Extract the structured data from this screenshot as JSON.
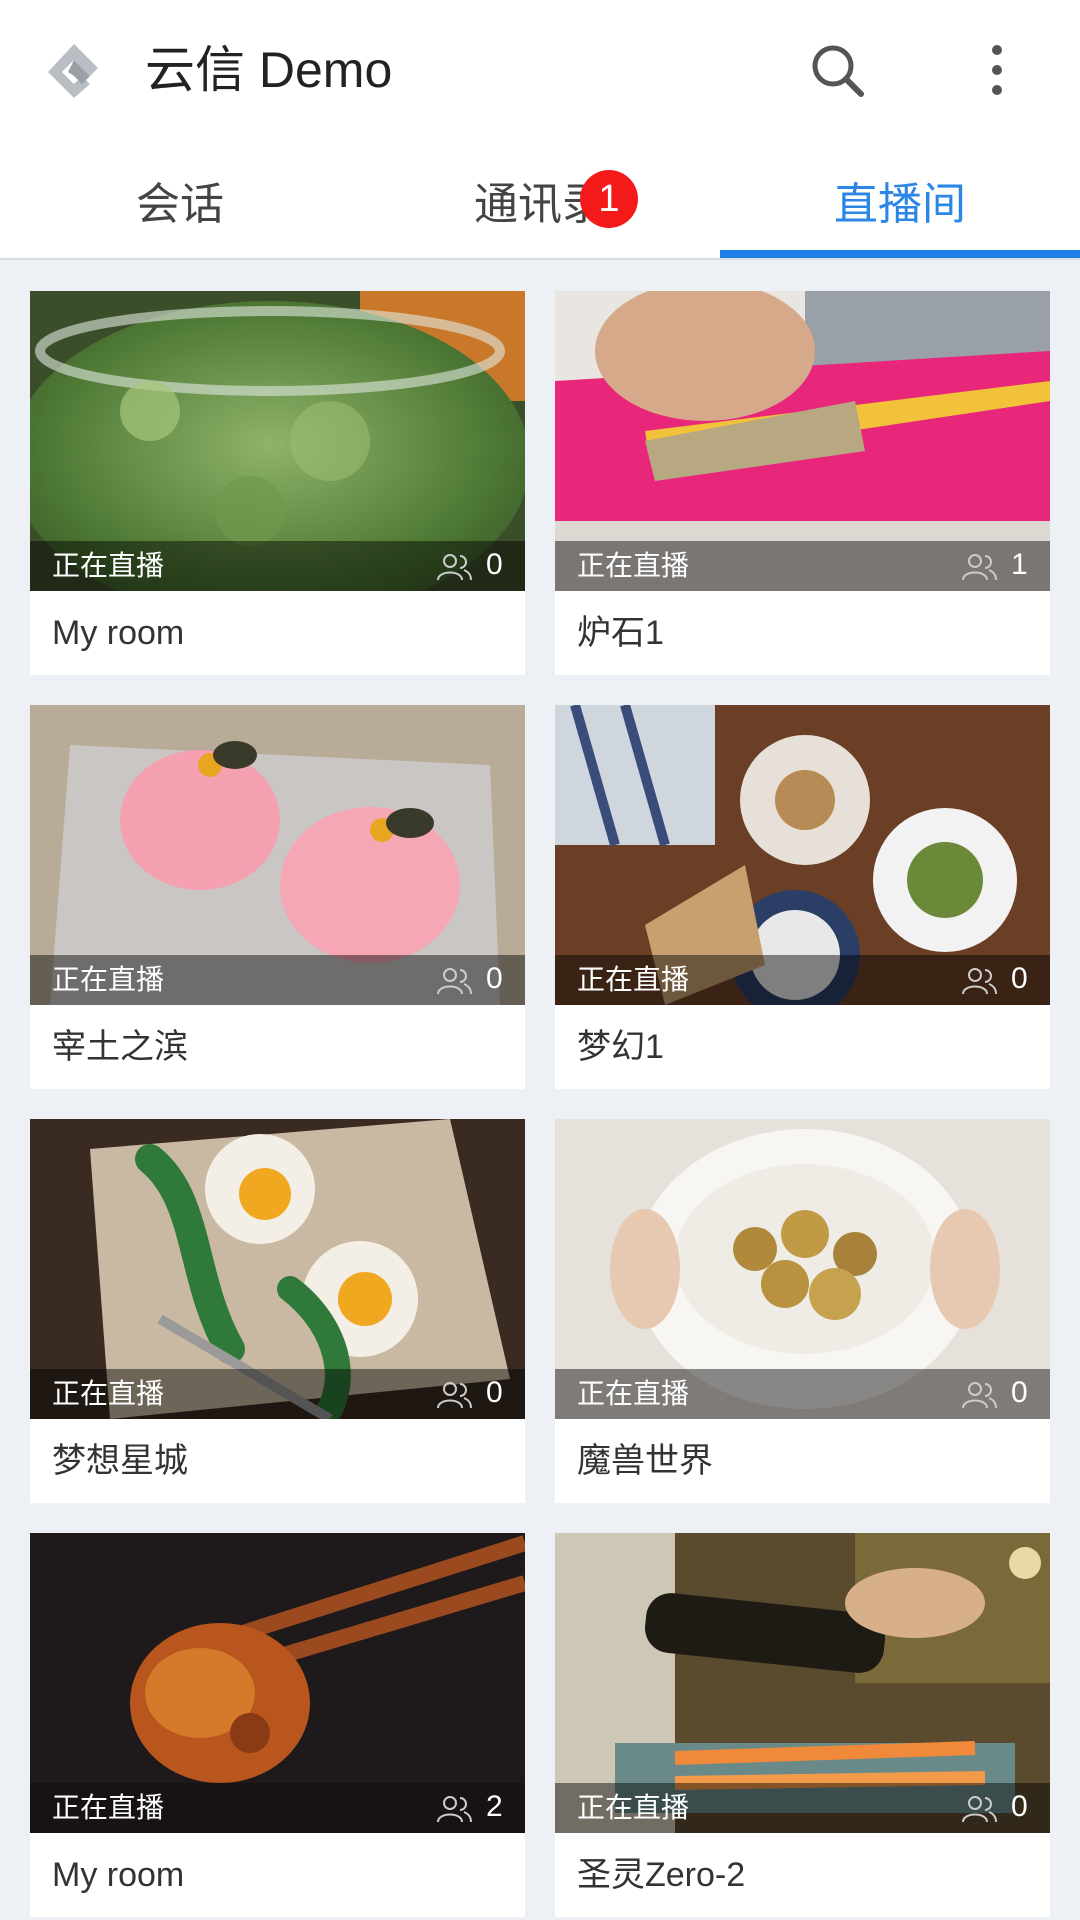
{
  "app": {
    "title": "云信 Demo"
  },
  "toolbar": {
    "search_icon": "search-icon",
    "more_icon": "more-vertical-icon"
  },
  "tabs": [
    {
      "label": "会话",
      "active": false
    },
    {
      "label": "通讯录",
      "active": false,
      "badge": "1"
    },
    {
      "label": "直播间",
      "active": true
    }
  ],
  "colors": {
    "accent": "#2b86e6",
    "badge": "#f51a1a",
    "background": "#edf1f5"
  },
  "rooms": [
    {
      "name": "My room",
      "status": "正在直播",
      "viewers": "0",
      "thumbnail": "mint-leaves-bowl"
    },
    {
      "name": "炉石1",
      "status": "正在直播",
      "viewers": "1",
      "thumbnail": "screen-printing-pink"
    },
    {
      "name": "宰土之滨",
      "status": "正在直播",
      "viewers": "0",
      "thumbnail": "pink-peach-sweets"
    },
    {
      "name": "梦幻1",
      "status": "正在直播",
      "viewers": "0",
      "thumbnail": "salad-plates-wood-table"
    },
    {
      "name": "梦想星城",
      "status": "正在直播",
      "viewers": "0",
      "thumbnail": "eggs-arugula-board"
    },
    {
      "name": "魔兽世界",
      "status": "正在直播",
      "viewers": "0",
      "thumbnail": "potatoes-white-bowl"
    },
    {
      "name": "My room",
      "status": "正在直播",
      "viewers": "2",
      "thumbnail": "fried-food-chopsticks"
    },
    {
      "name": "圣灵Zero-2",
      "status": "正在直播",
      "viewers": "0",
      "thumbnail": "pouring-oil-vegetables"
    }
  ]
}
